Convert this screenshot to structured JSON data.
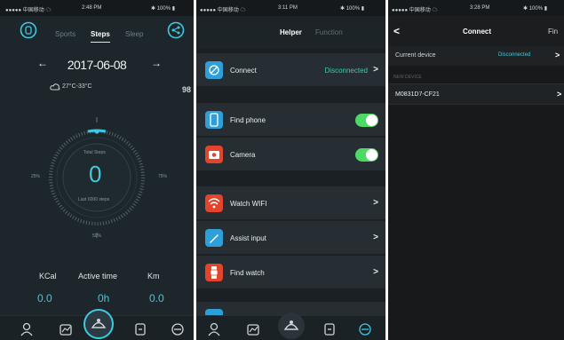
{
  "status_bars": [
    {
      "carrier": "●●●●● 中国移动 ☁",
      "time": "2:48 PM",
      "battery": "✱ 100% ▮"
    },
    {
      "carrier": "●●●●● 中国移动 ☁",
      "time": "3:11 PM",
      "battery": "✱ 100% ▮"
    },
    {
      "carrier": "●●●●● 中国移动 ☁",
      "time": "3:28 PM",
      "battery": "✱ 100% ▮"
    }
  ],
  "steps_screen": {
    "tabs": [
      "Sports",
      "Steps",
      "Sleep"
    ],
    "active_tab": "Steps",
    "date": "2017-06-08",
    "prev_arrow": "←",
    "next_arrow": "→",
    "weather": "27°C-33°C",
    "right_edge_text": "98",
    "dial": {
      "top_label": "Total Steps",
      "value": "0",
      "bottom_label": "Last 6000 steps",
      "left_label": "25%",
      "right_label": "75%",
      "bottom_mark": "50%"
    },
    "stats": [
      {
        "label": "KCal",
        "value": "0.0"
      },
      {
        "label": "Active time",
        "value": "0h"
      },
      {
        "label": "Km",
        "value": "0.0"
      }
    ],
    "accent_color": "#3fc9e0"
  },
  "helper_screen": {
    "tabs": [
      "Helper",
      "Function"
    ],
    "active_tab": "Helper",
    "rows": [
      {
        "label": "Connect",
        "value": "Disconnected",
        "icon": "bluetooth-icon",
        "color": "#2f9fd8",
        "control": "chevron"
      },
      {
        "label": "Find phone",
        "icon": "phone-icon",
        "color": "#2f9fd8",
        "control": "toggle"
      },
      {
        "label": "Camera",
        "icon": "camera-icon",
        "color": "#e2452c",
        "control": "toggle"
      },
      {
        "label": "Watch WIFI",
        "icon": "wifi-icon",
        "color": "#e2452c",
        "control": "chevron"
      },
      {
        "label": "Assist input",
        "icon": "pencil-icon",
        "color": "#2f9fd8",
        "control": "chevron"
      },
      {
        "label": "Find watch",
        "icon": "watch-icon",
        "color": "#e2452c",
        "control": "chevron"
      }
    ],
    "chevron": ">",
    "toggle_color": "#4cd964"
  },
  "connect_screen": {
    "back": "<",
    "title": "Connect",
    "right_action": "Fin",
    "current_label": "Current device",
    "current_value": "Disconnected",
    "section_label": "NEW DEVICE",
    "device_name": "M0831D7-CF21",
    "chevron": ">"
  }
}
